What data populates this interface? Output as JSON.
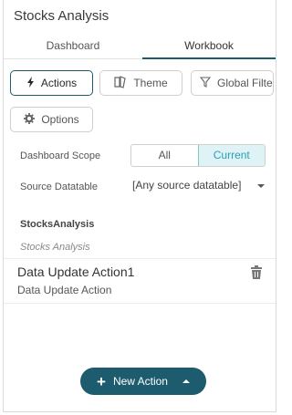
{
  "panel": {
    "title": "Stocks Analysis"
  },
  "tabs": [
    {
      "label": "Dashboard",
      "active": false
    },
    {
      "label": "Workbook",
      "active": true
    }
  ],
  "buttons": {
    "actions": {
      "label": "Actions",
      "icon": "lightning-icon",
      "active": true
    },
    "theme": {
      "label": "Theme",
      "icon": "theme-book-icon"
    },
    "global_filter": {
      "label": "Global Filter",
      "icon": "filter-icon"
    },
    "options": {
      "label": "Options",
      "icon": "gear-icon"
    }
  },
  "dashboard_scope": {
    "label": "Dashboard Scope",
    "options": [
      "All",
      "Current"
    ],
    "selected": "Current"
  },
  "source_datatable": {
    "label": "Source Datatable",
    "value": "[Any source datatable]"
  },
  "datasource": {
    "name": "StocksAnalysis",
    "description": "Stocks Analysis"
  },
  "action_item": {
    "name": "Data Update Action1",
    "type": "Data Update Action"
  },
  "new_action": {
    "label": "New Action"
  },
  "colors": {
    "accent": "#1c5c6e",
    "selected_bg": "#dff2f5",
    "selected_text": "#2aa0b8"
  }
}
